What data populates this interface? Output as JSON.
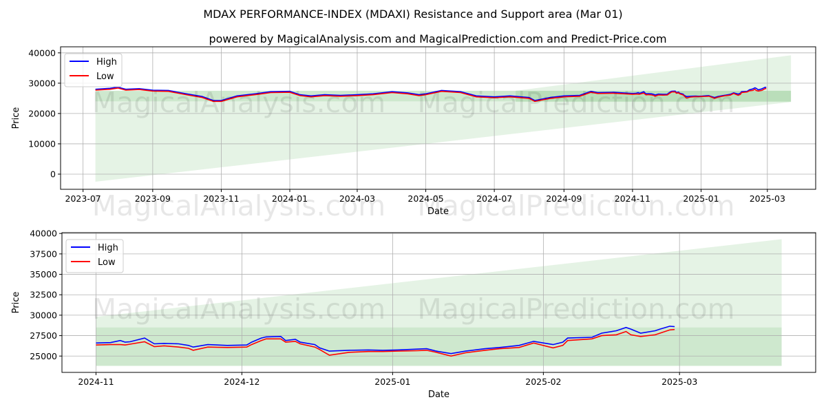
{
  "title": "MDAX PERFORMANCE-INDEX (MDAXI) Resistance and Support area (Mar 01)",
  "subtitle": "powered by MagicalAnalysis.com and MagicalPrediction.com and Predict-Price.com",
  "watermarks": [
    "MagicalAnalysis.com",
    "MagicalPrediction.com"
  ],
  "colors": {
    "high": "#0000ff",
    "low": "#ff0000",
    "zone": "#2ca02c"
  },
  "chart_data": [
    {
      "type": "line",
      "xlabel": "Date",
      "ylabel": "Price",
      "xlim": [
        "2023-06-11",
        "2025-04-13"
      ],
      "ylim": [
        -5000,
        42000
      ],
      "grid": true,
      "legend": "top-left",
      "xticks": [
        "2023-07",
        "2023-09",
        "2023-11",
        "2024-01",
        "2024-03",
        "2024-05",
        "2024-07",
        "2024-09",
        "2024-11",
        "2025-01",
        "2025-03"
      ],
      "yticks": [
        0,
        10000,
        20000,
        30000,
        40000
      ],
      "zones": [
        {
          "x": [
            "2023-07-12",
            "2025-03-22"
          ],
          "lower": [
            -2500,
            23800
          ],
          "upper": [
            27500,
            27500
          ]
        },
        {
          "x": [
            "2024-07-20",
            "2025-03-22"
          ],
          "lower": [
            23800,
            23800
          ],
          "upper": [
            27500,
            39200
          ]
        },
        {
          "x": [
            "2023-07-12",
            "2025-03-22"
          ],
          "lower": [
            24000,
            24000
          ],
          "upper": [
            27500,
            27500
          ]
        }
      ],
      "start": "2023-07-12"
    },
    {
      "type": "line",
      "xlabel": "Date",
      "ylabel": "Price",
      "xlim": [
        "2024-10-25",
        "2025-03-29"
      ],
      "ylim": [
        23000,
        40100
      ],
      "grid": true,
      "legend": "top-left",
      "xticks": [
        "2024-11",
        "2024-12",
        "2025-01",
        "2025-02",
        "2025-03"
      ],
      "yticks": [
        25000,
        27500,
        30000,
        32500,
        35000,
        37500,
        40000
      ],
      "zones": [
        {
          "x": [
            "2024-11-01",
            "2025-03-22"
          ],
          "lower": [
            23800,
            23800
          ],
          "upper": [
            29800,
            39300
          ]
        },
        {
          "x": [
            "2024-11-01",
            "2025-03-22"
          ],
          "lower": [
            23800,
            23800
          ],
          "upper": [
            28500,
            28500
          ]
        }
      ],
      "start": "2024-11-01"
    }
  ],
  "series": {
    "names": [
      "High",
      "Low"
    ],
    "dates": [
      "2023-07-12",
      "2023-07-25",
      "2023-08-01",
      "2023-08-08",
      "2023-08-20",
      "2023-09-01",
      "2023-09-15",
      "2023-10-01",
      "2023-10-15",
      "2023-10-25",
      "2023-11-01",
      "2023-11-15",
      "2023-12-01",
      "2023-12-15",
      "2024-01-01",
      "2024-01-10",
      "2024-01-20",
      "2024-02-01",
      "2024-02-15",
      "2024-03-01",
      "2024-03-15",
      "2024-04-01",
      "2024-04-15",
      "2024-04-25",
      "2024-05-01",
      "2024-05-15",
      "2024-06-01",
      "2024-06-15",
      "2024-07-01",
      "2024-07-15",
      "2024-08-01",
      "2024-08-06",
      "2024-08-20",
      "2024-09-01",
      "2024-09-15",
      "2024-09-25",
      "2024-10-01",
      "2024-10-15",
      "2024-11-01",
      "2024-11-04",
      "2024-11-06",
      "2024-11-07",
      "2024-11-08",
      "2024-11-11",
      "2024-11-13",
      "2024-11-15",
      "2024-11-18",
      "2024-11-20",
      "2024-11-21",
      "2024-11-24",
      "2024-11-28",
      "2024-12-02",
      "2024-12-03",
      "2024-12-05",
      "2024-12-06",
      "2024-12-09",
      "2024-12-10",
      "2024-12-12",
      "2024-12-13",
      "2024-12-16",
      "2024-12-17",
      "2024-12-19",
      "2024-12-23",
      "2024-12-27",
      "2024-12-30",
      "2025-01-02",
      "2025-01-06",
      "2025-01-08",
      "2025-01-10",
      "2025-01-13",
      "2025-01-16",
      "2025-01-20",
      "2025-01-23",
      "2025-01-27",
      "2025-01-30",
      "2025-02-03",
      "2025-02-05",
      "2025-02-06",
      "2025-02-11",
      "2025-02-13",
      "2025-02-16",
      "2025-02-18",
      "2025-02-19",
      "2025-02-21",
      "2025-02-24",
      "2025-02-25",
      "2025-02-27",
      "2025-02-28"
    ],
    "high": [
      28000,
      28300,
      28700,
      28000,
      28200,
      27700,
      27600,
      26500,
      25600,
      24300,
      24300,
      25800,
      26500,
      27200,
      27300,
      26200,
      25800,
      26200,
      26000,
      26200,
      26500,
      27200,
      26800,
      26200,
      26500,
      27600,
      27200,
      25800,
      25500,
      25800,
      25300,
      24300,
      25300,
      25800,
      26000,
      27300,
      26900,
      27000,
      26600,
      26650,
      26900,
      26700,
      26750,
      27200,
      26500,
      26550,
      26500,
      26300,
      26100,
      26400,
      26300,
      26350,
      26700,
      27200,
      27350,
      27400,
      26900,
      27050,
      26700,
      26400,
      26000,
      25600,
      25700,
      25750,
      25700,
      25750,
      25850,
      25900,
      25600,
      25300,
      25600,
      25900,
      26050,
      26300,
      26800,
      26400,
      26700,
      27200,
      27300,
      27800,
      28100,
      28500,
      28300,
      27800,
      28100,
      28300,
      28650,
      28600
    ],
    "low": [
      27700,
      28000,
      28400,
      27700,
      27900,
      27400,
      27300,
      26200,
      25300,
      24000,
      24000,
      25500,
      26200,
      26900,
      27000,
      25900,
      25500,
      25900,
      25700,
      25900,
      26200,
      26900,
      26500,
      25900,
      26200,
      27300,
      26900,
      25500,
      25200,
      25500,
      25000,
      24000,
      25000,
      25500,
      25700,
      27000,
      26600,
      26700,
      26350,
      26400,
      26400,
      26350,
      26450,
      26750,
      26150,
      26250,
      26100,
      25950,
      25700,
      26100,
      26050,
      26100,
      26400,
      26900,
      27100,
      27100,
      26700,
      26800,
      26500,
      26100,
      25800,
      25100,
      25450,
      25550,
      25550,
      25600,
      25650,
      25700,
      25450,
      25000,
      25400,
      25700,
      25900,
      26050,
      26600,
      26000,
      26300,
      26900,
      27100,
      27500,
      27600,
      28000,
      27600,
      27400,
      27600,
      27800,
      28200,
      28250
    ]
  }
}
